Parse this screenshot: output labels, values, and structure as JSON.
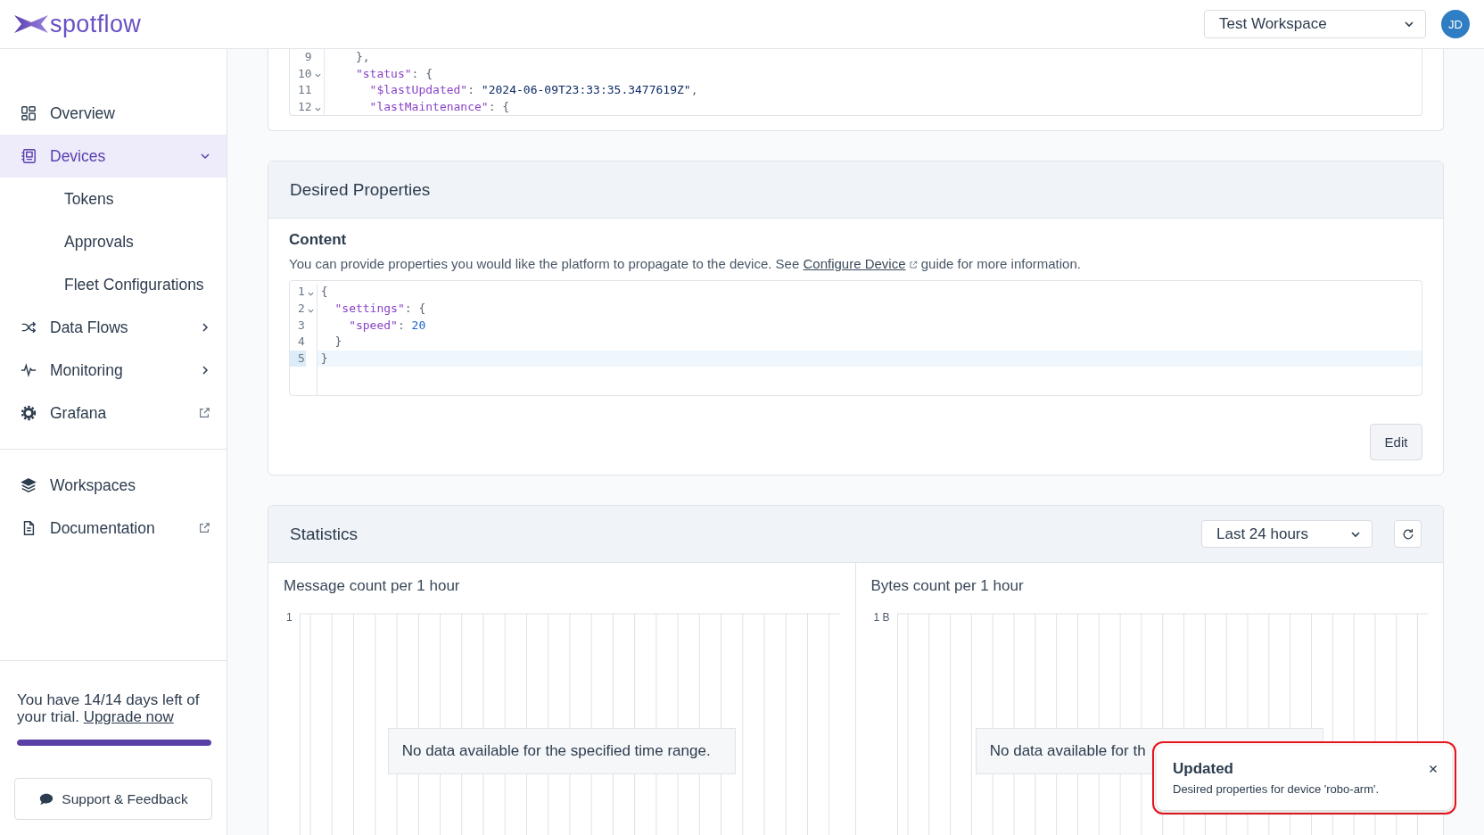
{
  "header": {
    "logo": "spotflow",
    "workspace": "Test Workspace",
    "avatar": "JD"
  },
  "sidebar": {
    "sections": [
      {
        "items": [
          {
            "label": "Overview",
            "kind": "link",
            "selected": false
          },
          {
            "label": "Devices",
            "kind": "group",
            "selected": true,
            "expanded": true,
            "children": [
              {
                "label": "Tokens",
                "selected": false
              },
              {
                "label": "Approvals",
                "selected": false
              },
              {
                "label": "Fleet Configurations",
                "selected": false
              }
            ]
          },
          {
            "label": "Data Flows",
            "kind": "group",
            "selected": false,
            "expanded": false
          },
          {
            "label": "Monitoring",
            "kind": "group",
            "selected": false,
            "expanded": false
          },
          {
            "label": "Grafana",
            "kind": "external",
            "selected": false
          }
        ]
      },
      {
        "items": [
          {
            "label": "Workspaces",
            "kind": "link",
            "selected": false
          },
          {
            "label": "Documentation",
            "kind": "external",
            "selected": false
          }
        ]
      }
    ],
    "trial": {
      "text": "You have 14/14 days left of your trial.",
      "link": "Upgrade now",
      "level": 1
    },
    "support_button": "Support & Feedback"
  },
  "top_card": {
    "editor": {
      "lines": [
        {
          "number": "9",
          "foldable": false,
          "active": false,
          "tokens": [
            {
              "kind": "punct",
              "text": "    },"
            }
          ]
        },
        {
          "number": "10",
          "foldable": true,
          "active": false,
          "tokens": [
            {
              "kind": "key",
              "text": "    \"status\""
            },
            {
              "kind": "punct",
              "text": ": {"
            }
          ]
        },
        {
          "number": "11",
          "foldable": false,
          "active": false,
          "tokens": [
            {
              "kind": "key",
              "text": "      \"$lastUpdated\""
            },
            {
              "kind": "punct",
              "text": ": "
            },
            {
              "kind": "string",
              "text": "\"2024-06-09T23:33:35.3477619Z\""
            },
            {
              "kind": "punct",
              "text": ","
            }
          ]
        },
        {
          "number": "12",
          "foldable": true,
          "active": false,
          "tokens": [
            {
              "kind": "key",
              "text": "      \"lastMaintenance\""
            },
            {
              "kind": "punct",
              "text": ": {"
            }
          ]
        }
      ]
    }
  },
  "desired_properties": {
    "title": "Desired Properties",
    "section_label": "Content",
    "description": {
      "before": "You can provide properties you would like the platform to propagate to the device. See",
      "link": "Configure Device",
      "after": "guide for more information."
    },
    "editor": {
      "lines": [
        {
          "number": "1",
          "foldable": true,
          "active": false,
          "tokens": [
            {
              "kind": "punct",
              "text": "{"
            }
          ]
        },
        {
          "number": "2",
          "foldable": true,
          "active": false,
          "tokens": [
            {
              "kind": "key",
              "text": "  \"settings\""
            },
            {
              "kind": "punct",
              "text": ": {"
            }
          ]
        },
        {
          "number": "3",
          "foldable": false,
          "active": false,
          "tokens": [
            {
              "kind": "key",
              "text": "    \"speed\""
            },
            {
              "kind": "punct",
              "text": ": "
            },
            {
              "kind": "number",
              "text": "20"
            }
          ]
        },
        {
          "number": "4",
          "foldable": false,
          "active": false,
          "tokens": [
            {
              "kind": "punct",
              "text": "  }"
            }
          ]
        },
        {
          "number": "5",
          "foldable": false,
          "active": true,
          "tokens": [
            {
              "kind": "punct",
              "text": "}"
            }
          ]
        }
      ]
    },
    "edit_button": "Edit"
  },
  "statistics": {
    "title": "Statistics",
    "range": "Last 24 hours",
    "charts": [
      {
        "title": "Message count per 1 hour",
        "y_tick": "1",
        "empty_message": "No data available for the specified time range."
      },
      {
        "title": "Bytes count per 1 hour",
        "y_tick": "1 B",
        "empty_message": "No data available for th"
      }
    ]
  },
  "toast": {
    "title": "Updated",
    "message": "Desired properties for device 'robo-arm'."
  }
}
